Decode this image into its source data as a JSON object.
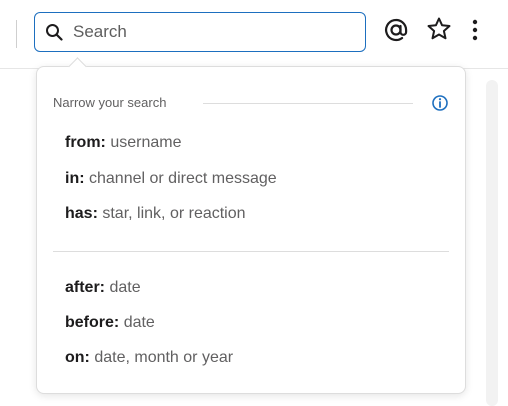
{
  "search": {
    "placeholder": "Search"
  },
  "dropdown": {
    "heading": "Narrow your search",
    "filters_group1": [
      {
        "keyword": "from:",
        "hint": "username"
      },
      {
        "keyword": "in:",
        "hint": "channel or direct message"
      },
      {
        "keyword": "has:",
        "hint": "star, link, or reaction"
      }
    ],
    "filters_group2": [
      {
        "keyword": "after:",
        "hint": "date"
      },
      {
        "keyword": "before:",
        "hint": "date"
      },
      {
        "keyword": "on:",
        "hint": "date, month or year"
      }
    ]
  },
  "icons": {
    "search": "search-icon",
    "mentions": "at-icon",
    "saved": "star-icon",
    "more": "more-vertical-icon",
    "info": "info-icon"
  },
  "colors": {
    "accent": "#1d6fbf",
    "text_primary": "#1d1c1d",
    "text_secondary": "#616061"
  }
}
